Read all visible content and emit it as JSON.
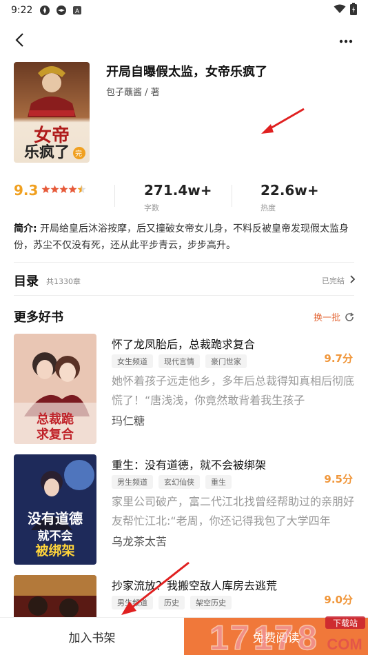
{
  "status_bar": {
    "time": "9:22"
  },
  "book": {
    "title": "开局自曝假太监，女帝乐疯了",
    "author": "包子蘸酱 / 著",
    "cover_text": "女帝乐疯了",
    "cover_badge": "完",
    "score": "9.3",
    "stars": 4.5,
    "words": "271.4w+",
    "words_label": "字数",
    "heat": "22.6w+",
    "heat_label": "热度",
    "intro_label": "简介:",
    "intro": " 开局给皇后沐浴按摩，后又撞破女帝女儿身，不料反被皇帝发现假太监身份，苏尘不仅没有死，还从此平步青云，步步高升。"
  },
  "toc": {
    "label": "目录",
    "count": "共1330章",
    "status": "已完结"
  },
  "more_books": {
    "heading": "更多好书",
    "refresh_label": "换一批",
    "items": [
      {
        "title": "怀了龙凤胎后，总裁跪求复合",
        "tags": [
          "女生频道",
          "现代言情",
          "豪门世家"
        ],
        "score": "9.7分",
        "desc": "她怀着孩子远走他乡，多年后总裁得知真相后彻底慌了！“唐浅浅，你竟然敢背着我生孩子",
        "author": "玛仁糖",
        "cover_text": "总裁跪求复合"
      },
      {
        "title": "重生：没有道德，就不会被绑架",
        "tags": [
          "男生频道",
          "玄幻仙侠",
          "重生"
        ],
        "score": "9.5分",
        "desc": "家里公司破产，富二代江北找曾经帮助过的亲朋好友帮忙江北:“老周，你还记得我包了大学四年",
        "author": "乌龙茶太苦",
        "cover_text": "没有道德就不会被绑架"
      },
      {
        "title": "抄家流放？我搬空敌人库房去逃荒",
        "tags": [
          "男生频道",
          "历史",
          "架空历史"
        ],
        "score": "9.0分",
        "desc": "",
        "author": "",
        "cover_text": ""
      }
    ]
  },
  "bottom_bar": {
    "add_shelf": "加入书架",
    "read": "免费阅读"
  },
  "colors": {
    "accent": "#f0783a",
    "score": "#f0a020",
    "rec_score": "#f0963a"
  }
}
